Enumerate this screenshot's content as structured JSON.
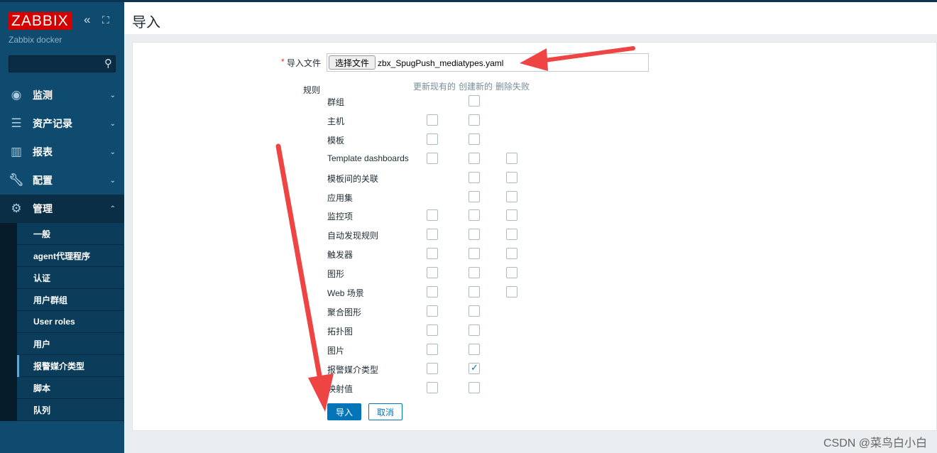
{
  "sidebar": {
    "logo": "ZABBIX",
    "server": "Zabbix docker",
    "collapse_icon": "«",
    "kiosk_icon": "⛶",
    "search_placeholder": "",
    "menu": [
      {
        "label": "监测",
        "icon": "eye-icon"
      },
      {
        "label": "资产记录",
        "icon": "list-icon"
      },
      {
        "label": "报表",
        "icon": "bar-chart-icon"
      },
      {
        "label": "配置",
        "icon": "wrench-icon"
      },
      {
        "label": "管理",
        "icon": "gear-icon"
      }
    ],
    "admin_items": [
      "一般",
      "agent代理程序",
      "认证",
      "用户群组",
      "User roles",
      "用户",
      "报警媒介类型",
      "脚本",
      "队列"
    ],
    "active_item": "报警媒介类型"
  },
  "header": {
    "title": "导入"
  },
  "form": {
    "file_label": "导入文件",
    "required": "*",
    "choose_file": "选择文件",
    "file_name": "zbx_SpugPush_mediatypes.yaml",
    "rules_label": "规则",
    "columns": [
      "更新现有的",
      "创建新的",
      "删除失败"
    ],
    "rules": [
      {
        "name": "群组",
        "update": null,
        "create": false,
        "delete": null
      },
      {
        "name": "主机",
        "update": false,
        "create": false,
        "delete": null
      },
      {
        "name": "模板",
        "update": false,
        "create": false,
        "delete": null
      },
      {
        "name": "Template dashboards",
        "update": false,
        "create": false,
        "delete": false
      },
      {
        "name": "模板间的关联",
        "update": null,
        "create": false,
        "delete": false
      },
      {
        "name": "应用集",
        "update": null,
        "create": false,
        "delete": false
      },
      {
        "name": "监控项",
        "update": false,
        "create": false,
        "delete": false
      },
      {
        "name": "自动发现规则",
        "update": false,
        "create": false,
        "delete": false
      },
      {
        "name": "触发器",
        "update": false,
        "create": false,
        "delete": false
      },
      {
        "name": "图形",
        "update": false,
        "create": false,
        "delete": false
      },
      {
        "name": "Web 场景",
        "update": false,
        "create": false,
        "delete": false
      },
      {
        "name": "聚合图形",
        "update": false,
        "create": false,
        "delete": null
      },
      {
        "name": "拓扑图",
        "update": false,
        "create": false,
        "delete": null
      },
      {
        "name": "图片",
        "update": false,
        "create": false,
        "delete": null
      },
      {
        "name": "报警媒介类型",
        "update": false,
        "create": true,
        "delete": null
      },
      {
        "name": "映射值",
        "update": false,
        "create": false,
        "delete": null
      }
    ],
    "import_button": "导入",
    "cancel_button": "取消"
  },
  "watermark": "CSDN @菜鸟白小白",
  "colors": {
    "sidebar": "#0e4b6e",
    "logo": "#d40000",
    "primary": "#0275b8",
    "annotation": "#ee4444"
  }
}
